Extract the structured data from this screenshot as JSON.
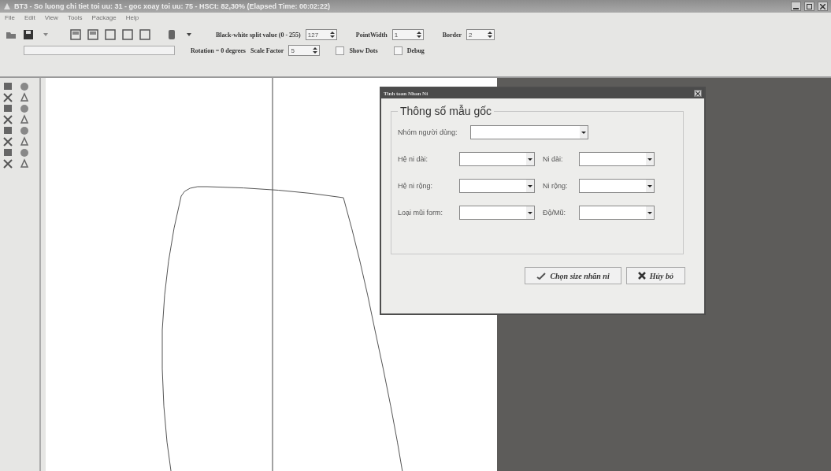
{
  "window": {
    "title": "BT3 - So luong chi tiet toi uu: 31 - goc xoay toi uu: 75 - HSCt: 82,30% (Elapsed Time: 00:02:22)"
  },
  "menu": [
    "File",
    "Edit",
    "View",
    "Tools",
    "Package",
    "Help"
  ],
  "toolbar": {
    "progress": {
      "level": 0
    },
    "split_label": "Black-white split value (0 - 255)",
    "split_value": "127",
    "point_width_label": "PointWidth",
    "point_width_value": "1",
    "border_label": "Border",
    "border_value": "2",
    "rotation": "Rotation = 0 degrees",
    "scale_label": "Scale Factor",
    "scale_value": "5",
    "checkboxes": [
      {
        "label": "Show Dots",
        "checked": false
      },
      {
        "label": "Debug",
        "checked": false
      }
    ]
  },
  "dialog": {
    "title": "Tinh toan Nhan Ni",
    "group": "Thông số mẫu gốc",
    "user_group_label": "Nhóm người dùng:",
    "rows": [
      {
        "left": "Hệ ni dài:",
        "right": "Ni dài:"
      },
      {
        "left": "Hệ ni rộng:",
        "right": "Ni rộng:"
      },
      {
        "left": "Loại mũi form:",
        "right": "Độ/Mũ:"
      }
    ],
    "buttons": [
      {
        "label": "Chọn size nhãn ni",
        "kind": "ok"
      },
      {
        "label": "Hủy bỏ",
        "kind": "cancel"
      }
    ]
  }
}
